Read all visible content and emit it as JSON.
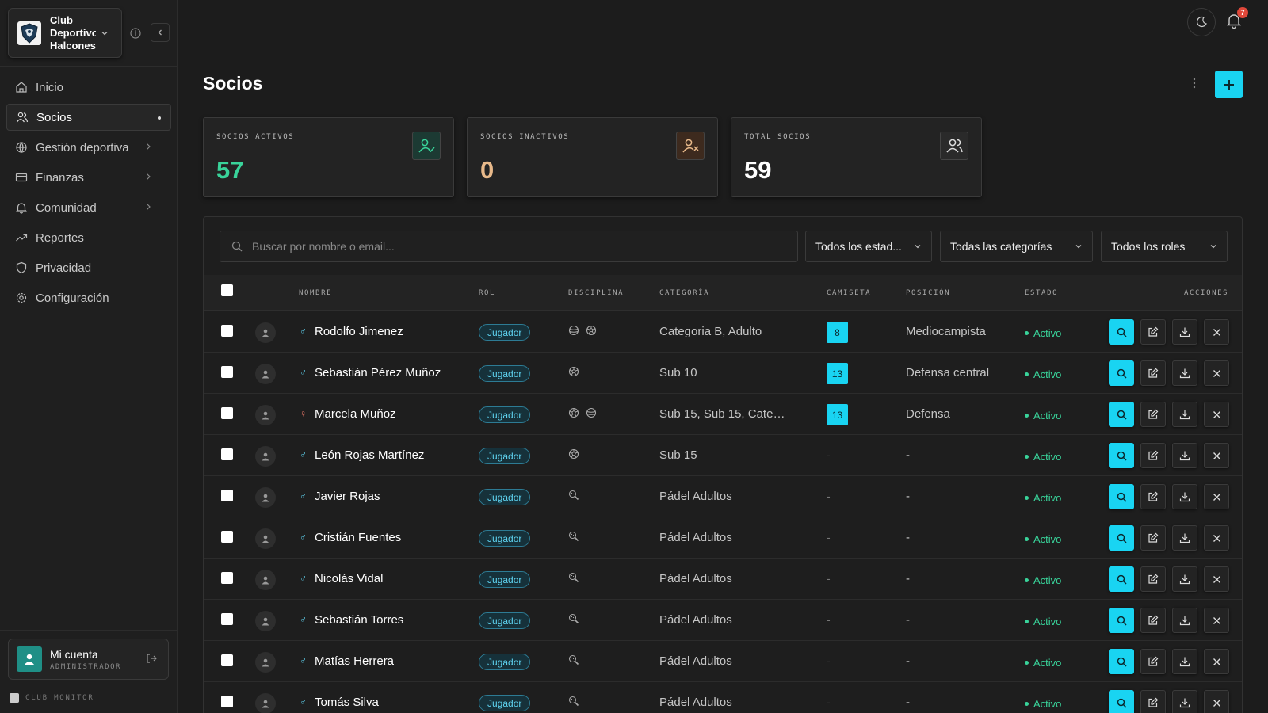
{
  "sidebar": {
    "club_name_lines": [
      "Club",
      "Deportivo",
      "Halcones"
    ],
    "nav": [
      {
        "label": "Inicio",
        "icon": "home-icon",
        "active": false,
        "chevron": false
      },
      {
        "label": "Socios",
        "icon": "users-icon",
        "active": true,
        "chevron": false
      },
      {
        "label": "Gestión deportiva",
        "icon": "globe-icon",
        "active": false,
        "chevron": true
      },
      {
        "label": "Finanzas",
        "icon": "card-icon",
        "active": false,
        "chevron": true
      },
      {
        "label": "Comunidad",
        "icon": "bell-icon",
        "active": false,
        "chevron": true
      },
      {
        "label": "Reportes",
        "icon": "trend-icon",
        "active": false,
        "chevron": false
      },
      {
        "label": "Privacidad",
        "icon": "shield-icon",
        "active": false,
        "chevron": false
      },
      {
        "label": "Configuración",
        "icon": "gear-icon",
        "active": false,
        "chevron": false
      }
    ],
    "account": {
      "name": "Mi cuenta",
      "role": "ADMINISTRADOR"
    },
    "footer": "CLUB MONITOR"
  },
  "topbar": {
    "notification_count": "7"
  },
  "page": {
    "title": "Socios"
  },
  "stats": [
    {
      "label": "SOCIOS ACTIVOS",
      "value": "57",
      "color": "#39d39a",
      "icon": "user-check-icon",
      "icon_bg": "#1c3a33"
    },
    {
      "label": "SOCIOS INACTIVOS",
      "value": "0",
      "color": "#e8b98a",
      "icon": "user-x-icon",
      "icon_bg": "#3d2a1e"
    },
    {
      "label": "TOTAL SOCIOS",
      "value": "59",
      "color": "#ffffff",
      "icon": "users-icon",
      "icon_bg": "#2a2a2a"
    }
  ],
  "filters": {
    "search_placeholder": "Buscar por nombre o email...",
    "estado": "Todos los estad...",
    "categoria": "Todas las categorías",
    "rol": "Todos los roles"
  },
  "table": {
    "headers": {
      "nombre": "NOMBRE",
      "rol": "ROL",
      "disciplina": "DISCIPLINA",
      "categoria": "CATEGORÍA",
      "camiseta": "CAMISETA",
      "posicion": "POSICIÓN",
      "estado": "ESTADO",
      "acciones": "ACCIONES"
    },
    "rows": [
      {
        "gender": "♂",
        "name": "Rodolfo Jimenez",
        "rol": "Jugador",
        "disciplines": [
          "volleyball-icon",
          "soccer-icon"
        ],
        "categoria": "Categoria B, Adulto",
        "camiseta": "8",
        "posicion": "Mediocampista",
        "estado": "Activo"
      },
      {
        "gender": "♂",
        "name": "Sebastián Pérez Muñoz",
        "rol": "Jugador",
        "disciplines": [
          "soccer-icon"
        ],
        "categoria": "Sub 10",
        "camiseta": "13",
        "posicion": "Defensa central",
        "estado": "Activo"
      },
      {
        "gender": "♀",
        "name": "Marcela Muñoz",
        "rol": "Jugador",
        "disciplines": [
          "soccer-icon",
          "volleyball-icon"
        ],
        "categoria": "Sub 15, Sub 15, Categor...",
        "camiseta": "13",
        "posicion": "Defensa",
        "estado": "Activo"
      },
      {
        "gender": "♂",
        "name": "León Rojas Martínez",
        "rol": "Jugador",
        "disciplines": [
          "soccer-icon"
        ],
        "categoria": "Sub 15",
        "camiseta": "-",
        "posicion": "-",
        "estado": "Activo"
      },
      {
        "gender": "♂",
        "name": "Javier Rojas",
        "rol": "Jugador",
        "disciplines": [
          "padel-icon"
        ],
        "categoria": "Pádel Adultos",
        "camiseta": "-",
        "posicion": "-",
        "estado": "Activo"
      },
      {
        "gender": "♂",
        "name": "Cristián Fuentes",
        "rol": "Jugador",
        "disciplines": [
          "padel-icon"
        ],
        "categoria": "Pádel Adultos",
        "camiseta": "-",
        "posicion": "-",
        "estado": "Activo"
      },
      {
        "gender": "♂",
        "name": "Nicolás Vidal",
        "rol": "Jugador",
        "disciplines": [
          "padel-icon"
        ],
        "categoria": "Pádel Adultos",
        "camiseta": "-",
        "posicion": "-",
        "estado": "Activo"
      },
      {
        "gender": "♂",
        "name": "Sebastián Torres",
        "rol": "Jugador",
        "disciplines": [
          "padel-icon"
        ],
        "categoria": "Pádel Adultos",
        "camiseta": "-",
        "posicion": "-",
        "estado": "Activo"
      },
      {
        "gender": "♂",
        "name": "Matías Herrera",
        "rol": "Jugador",
        "disciplines": [
          "padel-icon"
        ],
        "categoria": "Pádel Adultos",
        "camiseta": "-",
        "posicion": "-",
        "estado": "Activo"
      },
      {
        "gender": "♂",
        "name": "Tomás Silva",
        "rol": "Jugador",
        "disciplines": [
          "padel-icon"
        ],
        "categoria": "Pádel Adultos",
        "camiseta": "-",
        "posicion": "-",
        "estado": "Activo"
      }
    ]
  },
  "colors": {
    "accent": "#19d4f2",
    "male": "#5fd3f0",
    "female": "#f07a6a",
    "active": "#39d39a"
  }
}
